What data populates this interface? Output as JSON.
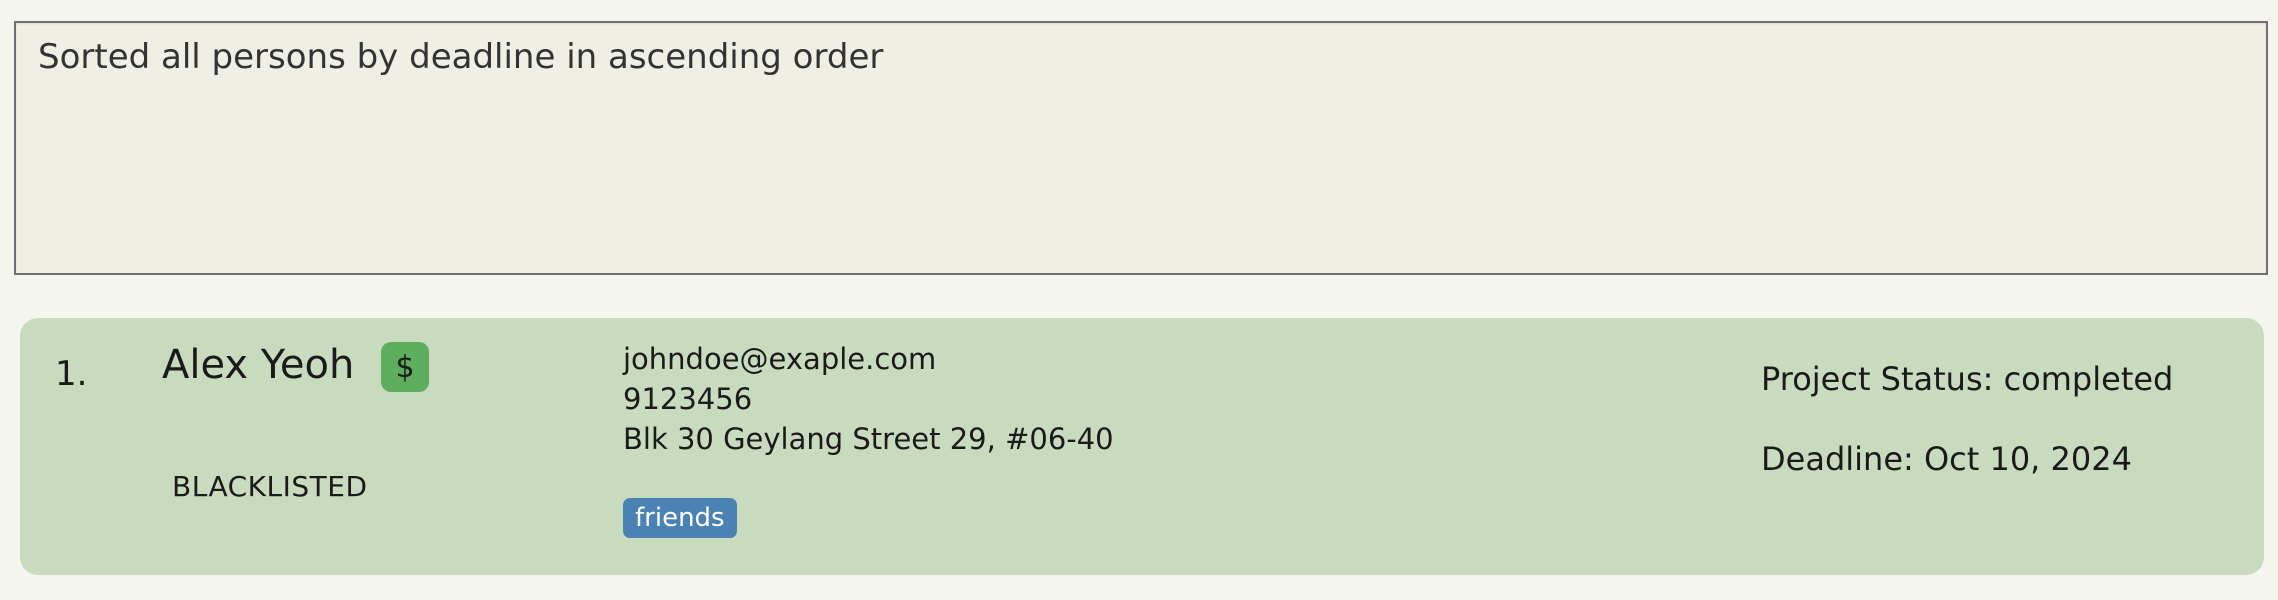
{
  "result_display": {
    "text": "Sorted all persons by deadline in ascending order"
  },
  "person_list": [
    {
      "index": "1.",
      "name": "Alex Yeoh",
      "payment_badge": "$",
      "blacklist_status": "BLACKLISTED",
      "email": "johndoe@exaple.com",
      "phone": "9123456",
      "address": "Blk 30 Geylang Street 29, #06-40",
      "tags": [
        "friends"
      ],
      "project_status": "Project Status: completed",
      "deadline": "Deadline: Oct 10, 2024"
    }
  ],
  "colors": {
    "background": "#f5f5ef",
    "result_box": "#efefe6",
    "card": "#c9dbbf",
    "badge": "#5fae5f",
    "tag": "#4a83b3"
  }
}
